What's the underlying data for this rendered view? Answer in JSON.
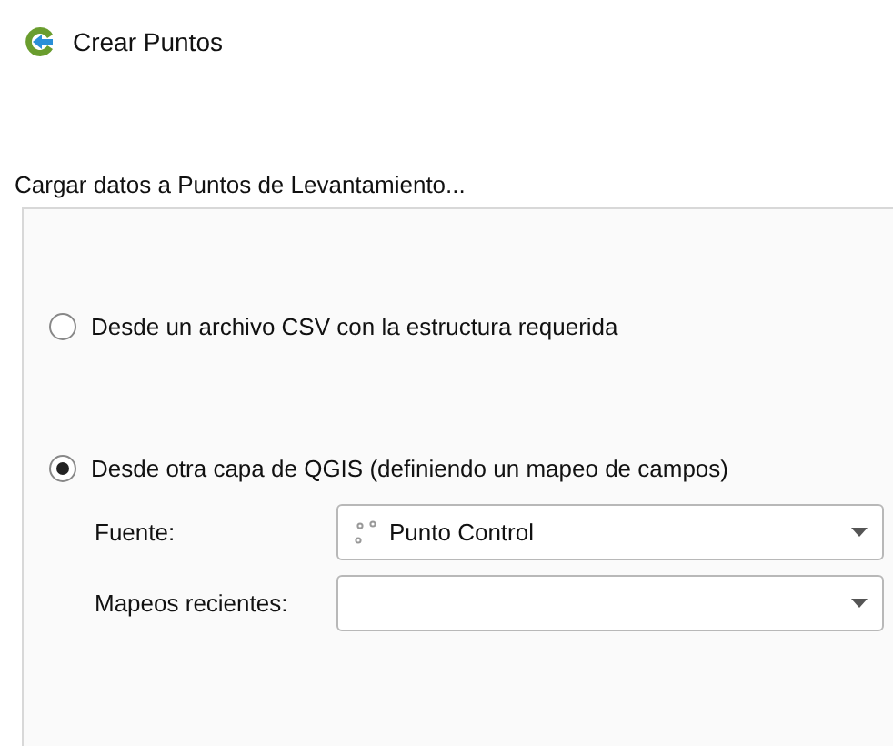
{
  "window": {
    "title": "Crear Puntos"
  },
  "group": {
    "title": "Cargar datos a Puntos de Levantamiento...",
    "options": [
      {
        "label": "Desde un archivo CSV con la estructura requerida",
        "selected": false
      },
      {
        "label": "Desde otra capa de QGIS (definiendo un mapeo de campos)",
        "selected": true
      }
    ],
    "fields": [
      {
        "label": "Fuente:",
        "value": "Punto Control",
        "kind": "layer"
      },
      {
        "label": "Mapeos recientes:",
        "kind": "empty"
      }
    ]
  }
}
